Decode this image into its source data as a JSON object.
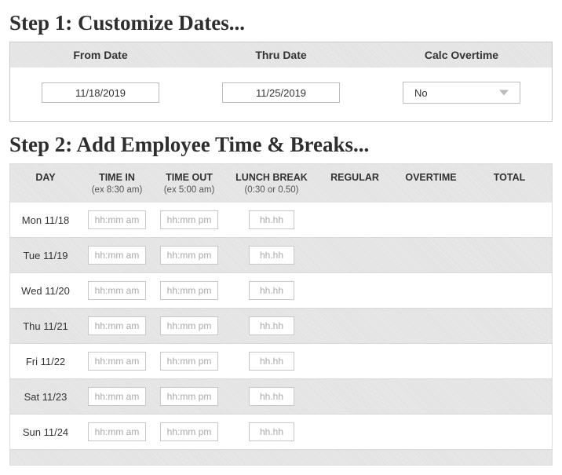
{
  "step1": {
    "title": "Step 1: Customize Dates...",
    "headers": {
      "from": "From Date",
      "thru": "Thru Date",
      "overtime": "Calc Overtime"
    },
    "from_value": "11/18/2019",
    "thru_value": "11/25/2019",
    "overtime_value": "No"
  },
  "step2": {
    "title": "Step 2: Add Employee Time & Breaks...",
    "headers": {
      "day": "DAY",
      "time_in": "TIME IN",
      "time_in_hint": "(ex 8:30 am)",
      "time_out": "TIME OUT",
      "time_out_hint": "(ex 5:00 am)",
      "lunch": "LUNCH BREAK",
      "lunch_hint": "(0:30 or 0.50)",
      "regular": "REGULAR",
      "overtime": "OVERTIME",
      "total": "TOTAL"
    },
    "placeholders": {
      "time_in": "hh:mm am",
      "time_out": "hh:mm pm",
      "break": "hh.hh"
    },
    "rows": [
      {
        "day": "Mon 11/18"
      },
      {
        "day": "Tue 11/19"
      },
      {
        "day": "Wed 11/20"
      },
      {
        "day": "Thu 11/21"
      },
      {
        "day": "Fri 11/22"
      },
      {
        "day": "Sat 11/23"
      },
      {
        "day": "Sun 11/24"
      }
    ]
  }
}
